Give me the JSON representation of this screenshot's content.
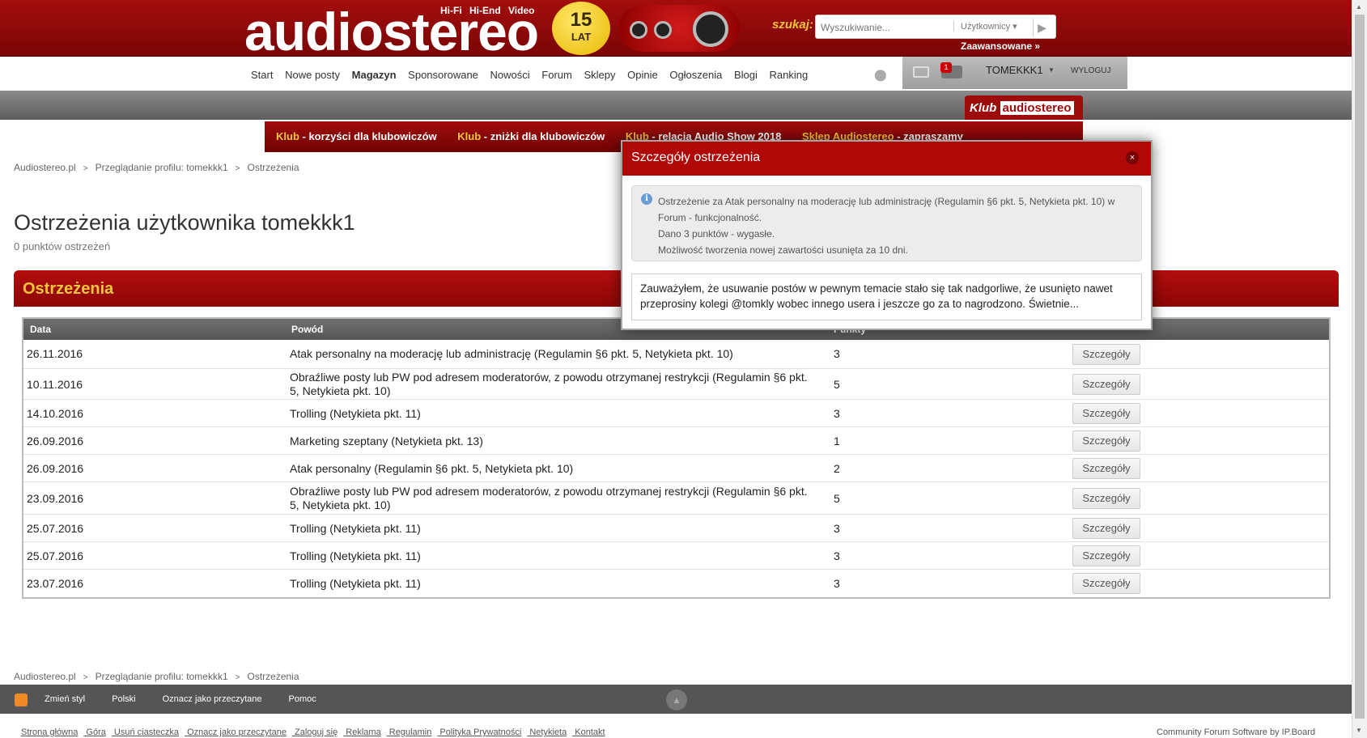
{
  "header": {
    "logo_text": "audiostereo",
    "logo_tags": "Hi-Fi Hi-End Video",
    "badge_number": "15",
    "badge_label": "LAT",
    "search_label": "szukaj:",
    "search_placeholder": "Wyszukiwanie...",
    "search_scope": "Użytkownicy ▾",
    "advanced_link": "Zaawansowane »"
  },
  "nav": {
    "items": [
      "Start",
      "Nowe posty",
      "Magazyn",
      "Sponsorowane",
      "Nowości",
      "Forum",
      "Sklepy",
      "Opinie",
      "Ogłoszenia",
      "Blogi",
      "Ranking"
    ]
  },
  "user_panel": {
    "notification_count": "1",
    "username": "TOMEKKK1",
    "logout": "WYLOGUJ"
  },
  "klub_logo": {
    "klub": "Klub",
    "brand": "audiostereo"
  },
  "promo": [
    {
      "k": "Klub",
      "t": " - korzyści dla klubowiczów"
    },
    {
      "k": "Klub",
      "t": " - zniżki dla klubowiczów"
    },
    {
      "k": "Klub",
      "t": " - relacja Audio Show 2018"
    },
    {
      "k": "Sklep Audiostereo",
      "t": " - zapraszamy"
    }
  ],
  "breadcrumb": [
    "Audiostereo.pl",
    "Przeglądanie profilu: tomekkk1",
    "Ostrzeżenia"
  ],
  "page": {
    "title": "Ostrzeżenia użytkownika tomekkk1",
    "points": "0 punktów ostrzeżeń",
    "section_title": "Ostrzeżenia"
  },
  "table": {
    "headers": {
      "date": "Data",
      "reason": "Powód",
      "points": "Punkty"
    },
    "details_label": "Szczegóły",
    "rows": [
      {
        "date": "26.11.2016",
        "reason": "Atak personalny na moderację lub administrację (Regulamin §6 pkt. 5, Netykieta pkt. 10)",
        "points": "3"
      },
      {
        "date": "10.11.2016",
        "reason": "Obraźliwe posty lub PW pod adresem moderatorów, z powodu otrzymanej restrykcji (Regulamin §6 pkt. 5, Netykieta pkt. 10)",
        "points": "5"
      },
      {
        "date": "14.10.2016",
        "reason": "Trolling (Netykieta pkt. 11)",
        "points": "3"
      },
      {
        "date": "26.09.2016",
        "reason": "Marketing szeptany (Netykieta pkt. 13)",
        "points": "1"
      },
      {
        "date": "26.09.2016",
        "reason": "Atak personalny (Regulamin §6 pkt. 5, Netykieta pkt. 10)",
        "points": "2"
      },
      {
        "date": "23.09.2016",
        "reason": "Obraźliwe posty lub PW pod adresem moderatorów, z powodu otrzymanej restrykcji (Regulamin §6 pkt. 5, Netykieta pkt. 10)",
        "points": "5"
      },
      {
        "date": "25.07.2016",
        "reason": "Trolling (Netykieta pkt. 11)",
        "points": "3"
      },
      {
        "date": "25.07.2016",
        "reason": "Trolling (Netykieta pkt. 11)",
        "points": "3"
      },
      {
        "date": "23.07.2016",
        "reason": "Trolling (Netykieta pkt. 11)",
        "points": "3"
      }
    ]
  },
  "modal": {
    "title": "Szczegóły ostrzeżenia",
    "close": "×",
    "info_lines": [
      "Ostrzeżenie za Atak personalny na moderację lub administrację (Regulamin §6 pkt. 5, Netykieta pkt. 10) w Forum - funkcjonalność.",
      "Dano 3 punktów - wygasłe.",
      "Możliwość tworzenia nowej zawartości usunięta za 10 dni."
    ],
    "message": "Zauważyłem, że usuwanie postów w pewnym temacie stało się tak nadgorliwe, że usunięto nawet przeprosiny kolegi @tomkly wobec innego usera i jeszcze go za to nagrodzono. Świetnie..."
  },
  "footer": {
    "links": [
      "Zmień styl",
      "Polski",
      "Oznacz jako przeczytane",
      "Pomoc"
    ],
    "bottom_links": [
      "Strona główna",
      "Góra",
      "Usuń ciasteczka",
      "Oznacz jako przeczytane",
      "Zaloguj się",
      "Reklama",
      "Regulamin",
      "Polityka Prywatności",
      "Netykieta",
      "Kontakt"
    ],
    "powered": "Community Forum Software by IP.Board"
  }
}
